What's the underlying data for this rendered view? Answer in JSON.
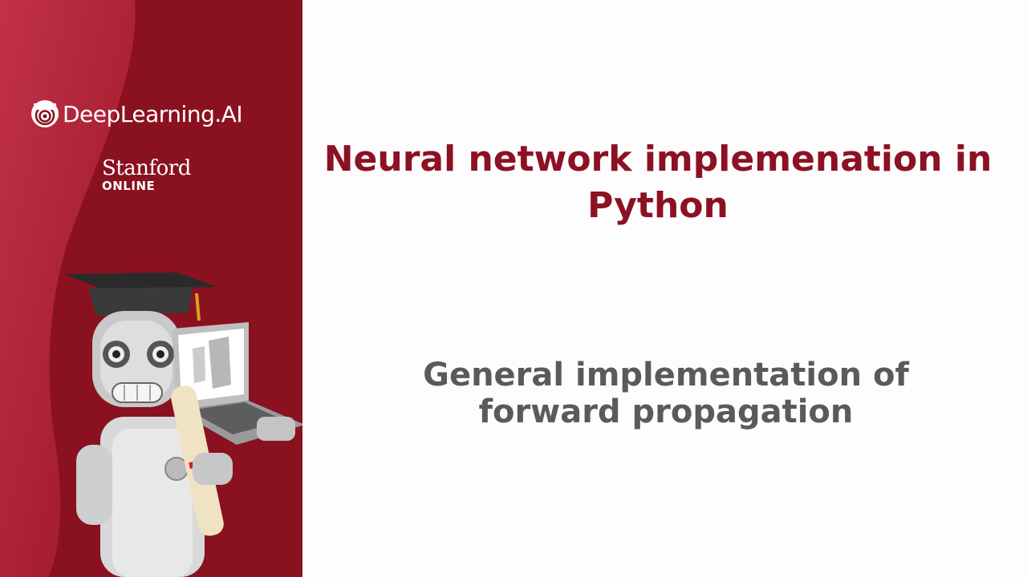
{
  "brand": {
    "deeplearning_logo_text": "DeepLearning.AI",
    "stanford_name": "Stanford",
    "stanford_online": "ONLINE"
  },
  "slide": {
    "title": "Neural network implemenation in Python",
    "subtitle": "General implementation of forward propagation"
  },
  "colors": {
    "sidebar": "#8a1120",
    "title": "#8c1122",
    "subtitle": "#5a5a5a",
    "background": "#fdfdfd"
  },
  "icons": [
    "deeplearning-logo-icon",
    "robot-mascot-illustration"
  ]
}
